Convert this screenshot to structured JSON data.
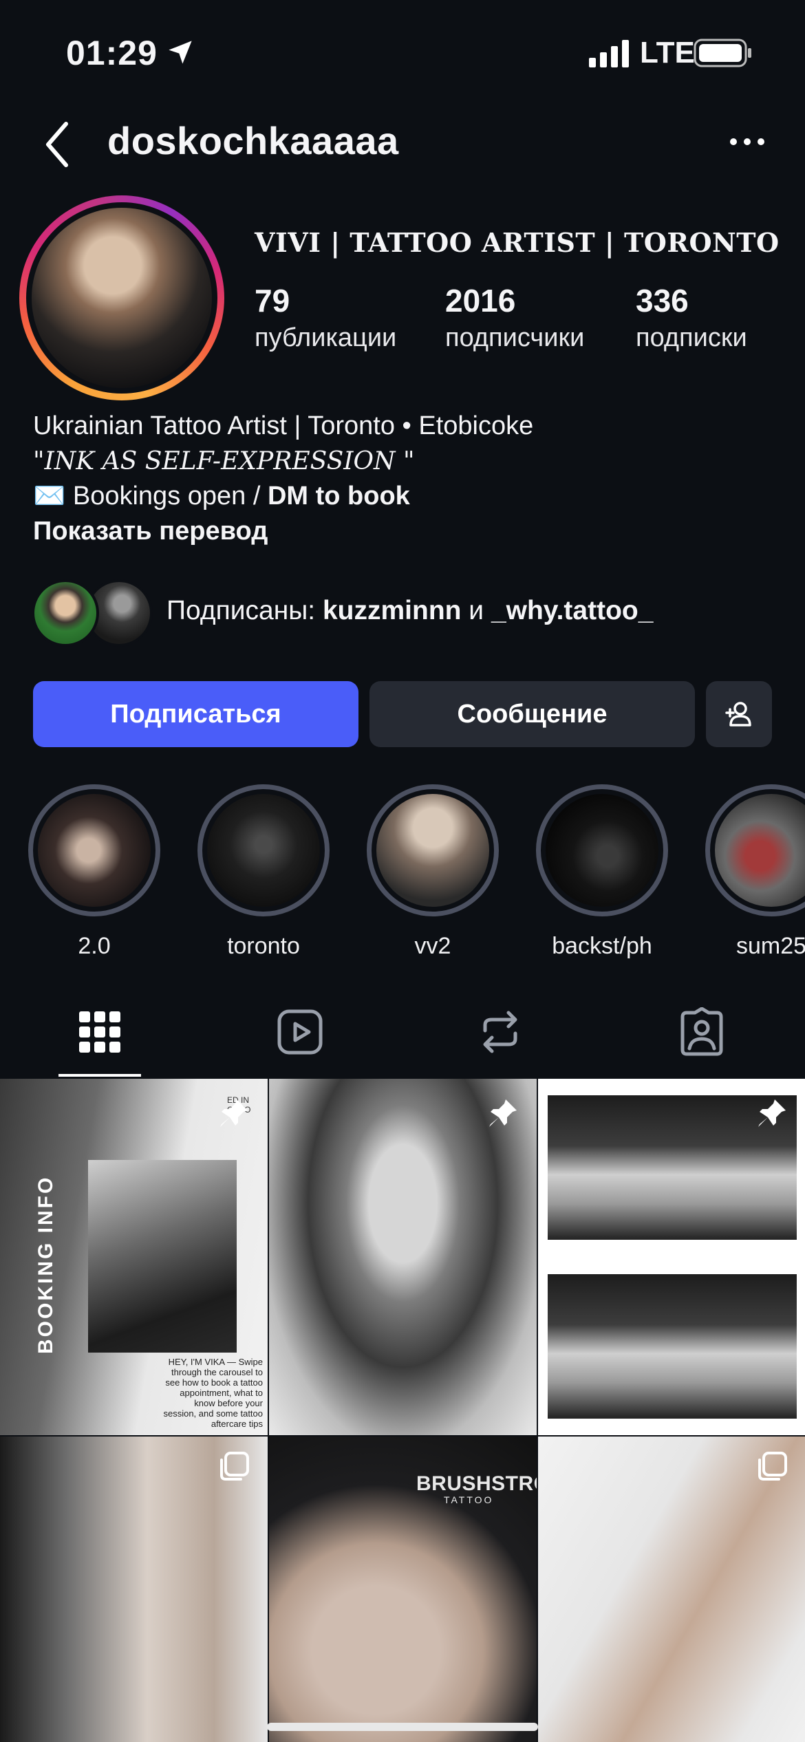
{
  "status_bar": {
    "time": "01:29",
    "network": "LTE"
  },
  "header": {
    "username": "doskochkaaaaa"
  },
  "profile": {
    "display_name": "VIVI | TATTOO ARTIST | TORONTO",
    "stats": [
      {
        "value": "79",
        "label": "публикации"
      },
      {
        "value": "2016",
        "label": "подписчики"
      },
      {
        "value": "336",
        "label": "подписки"
      }
    ],
    "bio": {
      "line1": "Ukrainian Tattoo Artist | Toronto • Etobicoke",
      "line2": "\"INK AS SELF-EXPRESSION \"",
      "line3_prefix": "✉️ Bookings open / ",
      "line3_bold": "DM to book",
      "translate": "Показать перевод"
    },
    "mutuals": {
      "prefix": "Подписаны: ",
      "user1": "kuzzminnn",
      "joiner": " и ",
      "user2": "_why.tattoo_"
    }
  },
  "actions": {
    "follow": "Подписаться",
    "message": "Сообщение"
  },
  "highlights": [
    {
      "label": "2.0",
      "colors": [
        "#c9b3a3",
        "#3a2d2a"
      ]
    },
    {
      "label": "toronto",
      "colors": [
        "#4a4a4a",
        "#0d0d0d"
      ]
    },
    {
      "label": "vv2",
      "colors": [
        "#d8c8b8",
        "#2a2a2a"
      ]
    },
    {
      "label": "backst/ph",
      "colors": [
        "#3a3a3a",
        "#050505"
      ]
    },
    {
      "label": "sum25",
      "colors": [
        "#a23a3a",
        "#2a2a2a"
      ]
    }
  ],
  "tabs": [
    "grid",
    "reels",
    "reposts",
    "tagged"
  ],
  "grid_posts": {
    "post1_vertical": "BOOKING INFO",
    "post1_top": "ED IN ONTO",
    "post1_caption": "HEY, I'M VIKA — Swipe through the carousel to see how to book a tattoo appointment, what to know before your session, and some tattoo aftercare tips",
    "post5_brand": "BRUSHSTROKE",
    "post5_sub": "TATTOO"
  }
}
